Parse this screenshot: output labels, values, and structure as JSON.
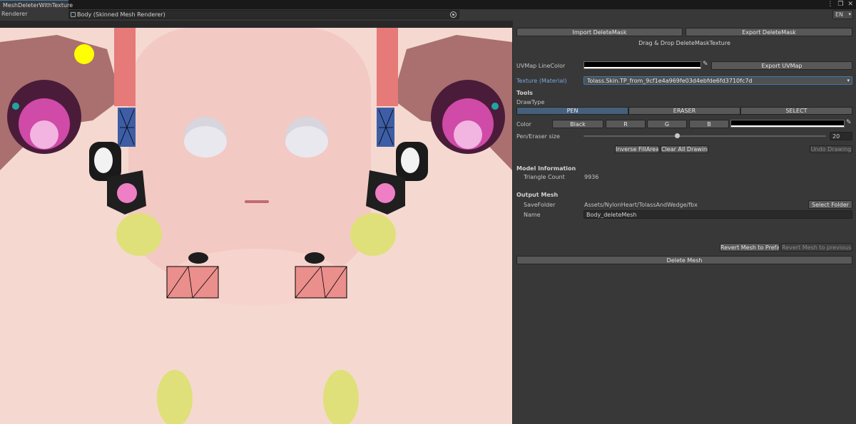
{
  "window": {
    "tab_title": "MeshDeleterWithTexture"
  },
  "renderer": {
    "label": "Renderer",
    "value": "Body (Skinned Mesh Renderer)",
    "language": "EN"
  },
  "actions": {
    "import_mask": "Import DeleteMask",
    "export_mask": "Export DeleteMask",
    "drag_drop": "Drag & Drop DeleteMaskTexture"
  },
  "uv": {
    "label": "UVMap LineColor",
    "line_color": "#000000",
    "export_uv": "Export UVMap"
  },
  "texture": {
    "label": "Texture (Material)",
    "value": "Tolass.Skin.TP_from_9cf1e4a969fe03d4ebfde6fd3710fc7d"
  },
  "tools": {
    "header": "Tools",
    "drawtype_label": "DrawType",
    "drawtypes": [
      "PEN",
      "ERASER",
      "SELECT"
    ],
    "selected": "PEN",
    "color_label": "Color",
    "color_buttons": [
      "Black",
      "R",
      "G",
      "B"
    ],
    "current_color": "#000000",
    "size_label": "Pen/Eraser size",
    "size_value": "20",
    "inverse": "Inverse FillArea",
    "clear": "Clear All Drawing",
    "undo": "Undo Drawing"
  },
  "model": {
    "header": "Model Information",
    "triangle_label": "Triangle Count",
    "triangle_count": "9936"
  },
  "output": {
    "header": "Output Mesh",
    "folder_label": "SaveFolder",
    "folder_value": "Assets/NylonHeart/TolassAndWedge/fbx",
    "select_folder": "Select Folder",
    "name_label": "Name",
    "name_value": "Body_deleteMesh"
  },
  "revert": {
    "prefab": "Revert Mesh to Prefab",
    "previous": "Revert Mesh to previously"
  },
  "delete": "Delete Mesh",
  "colors": {
    "accent": "#3a79bb",
    "pen_cursor": "#ffff00",
    "skin": "#f6d8cf"
  }
}
